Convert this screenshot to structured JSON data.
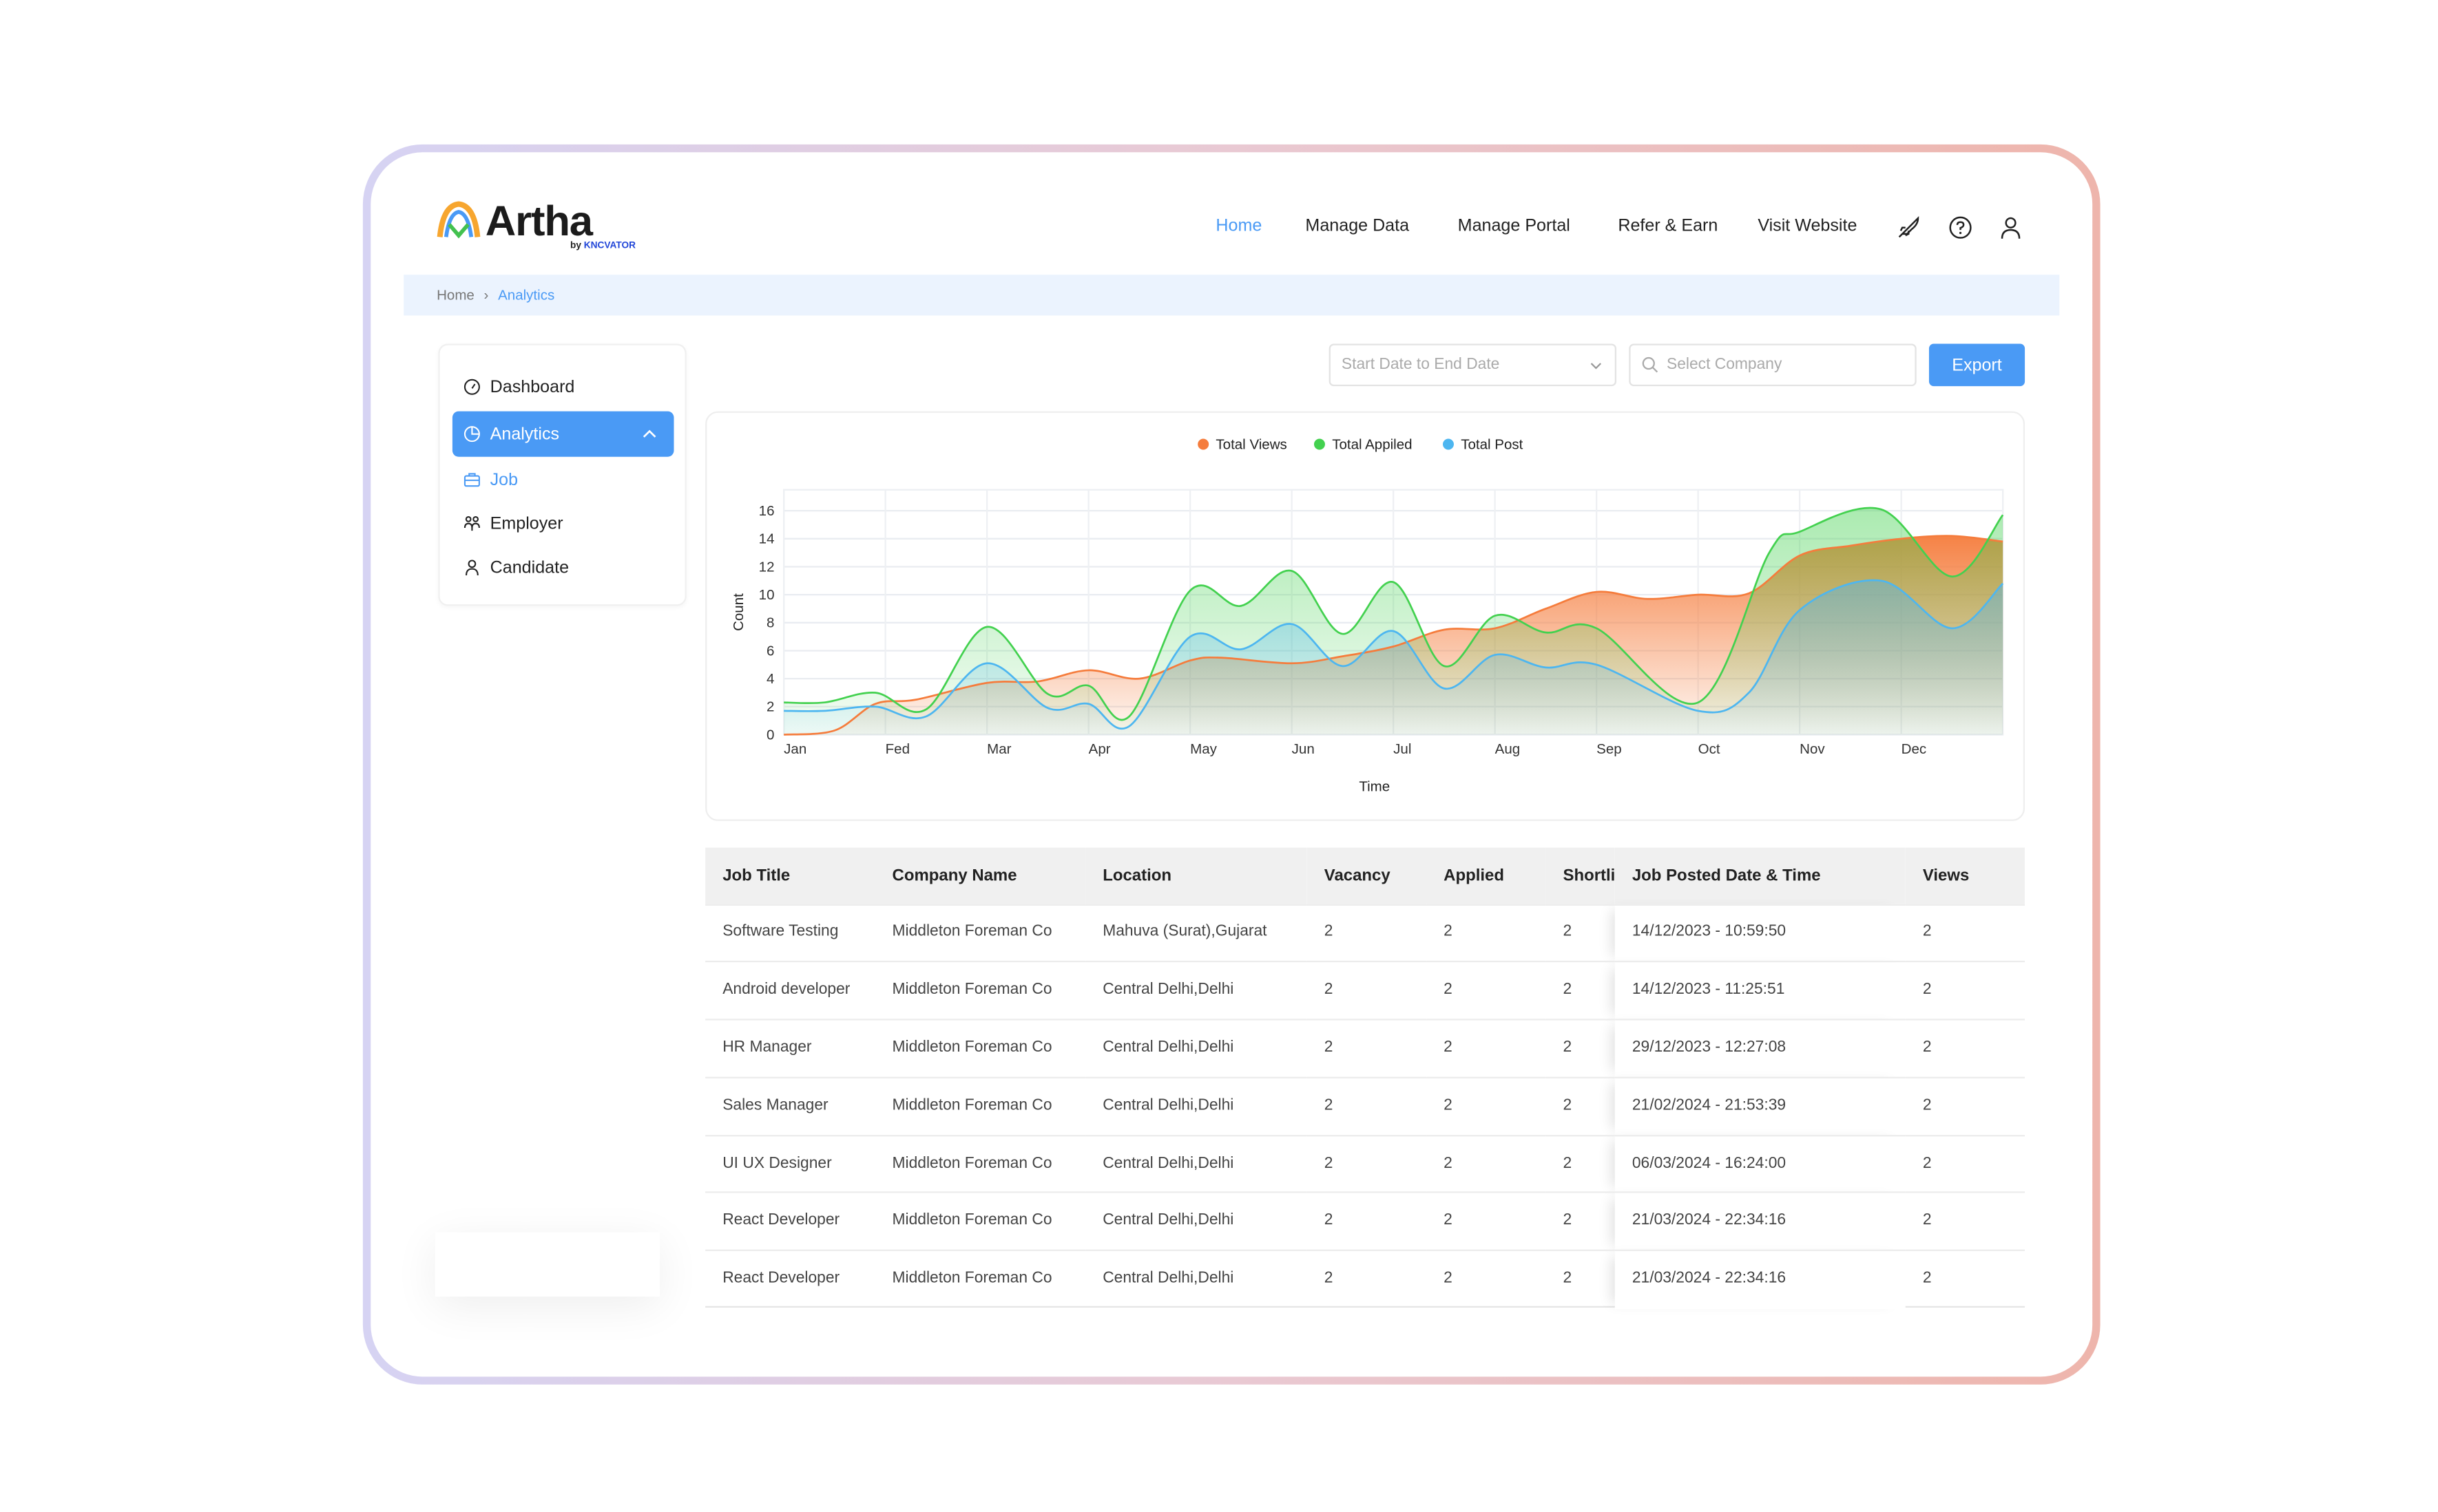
{
  "brand": {
    "name": "Artha",
    "by": "by",
    "maker": "KNCVATOR"
  },
  "nav": {
    "items": [
      {
        "label": "Home",
        "active": true
      },
      {
        "label": "Manage Data"
      },
      {
        "label": "Manage Portal"
      },
      {
        "label": "Refer & Earn"
      },
      {
        "label": "Visit Website"
      }
    ],
    "icons": [
      "rocket-icon",
      "help-icon",
      "user-icon"
    ]
  },
  "breadcrumb": {
    "home": "Home",
    "current": "Analytics"
  },
  "sidebar": {
    "items": [
      {
        "label": "Dashboard",
        "icon": "dashboard-icon"
      },
      {
        "label": "Analytics",
        "icon": "pie-chart-icon",
        "active": true,
        "expanded": true
      },
      {
        "label": "Job",
        "icon": "briefcase-icon",
        "sub": true
      },
      {
        "label": "Employer",
        "icon": "users-icon"
      },
      {
        "label": "Candidate",
        "icon": "user-icon"
      }
    ]
  },
  "filters": {
    "date_placeholder": "Start Date to End Date",
    "company_placeholder": "Select Company",
    "export_label": "Export"
  },
  "colors": {
    "accent": "#4a9af5",
    "views": "#f57c3c",
    "applied": "#43d14f",
    "post": "#4db6f0"
  },
  "chart_data": {
    "type": "area",
    "xlabel": "Time",
    "ylabel": "Count",
    "x_ticks": [
      "Jan",
      "Fed",
      "Mar",
      "Apr",
      "May",
      "Jun",
      "Jul",
      "Aug",
      "Sep",
      "Oct",
      "Nov",
      "Dec"
    ],
    "y_ticks": [
      0,
      2,
      4,
      6,
      8,
      10,
      12,
      14,
      16
    ],
    "ylim": [
      0,
      17.5
    ],
    "xlim": [
      1,
      13
    ],
    "grid": true,
    "legend": "top-center",
    "series": [
      {
        "name": "Total Views",
        "x": [
          1,
          1.5,
          1.9,
          2.3,
          3,
          3.5,
          4,
          4.5,
          5,
          5.3,
          6,
          6.5,
          7,
          7.5,
          8,
          8.5,
          9,
          9.5,
          10,
          10.5,
          11,
          11.5,
          12,
          12.5,
          13
        ],
        "values": [
          0,
          0.3,
          2.2,
          2.5,
          3.7,
          3.8,
          4.6,
          4.0,
          5.3,
          5.5,
          5.1,
          5.6,
          6.3,
          7.5,
          7.6,
          9.0,
          10.2,
          9.7,
          10.0,
          10.1,
          12.8,
          13.5,
          14.0,
          14.2,
          13.8
        ]
      },
      {
        "name": "Total Appiled",
        "x": [
          1,
          1.4,
          1.9,
          2.4,
          3,
          3.6,
          4,
          4.4,
          5,
          5.5,
          6,
          6.5,
          7,
          7.5,
          8,
          8.5,
          9,
          10,
          10.7,
          11,
          11.8,
          12.5,
          13
        ],
        "values": [
          2.3,
          2.3,
          3.0,
          1.8,
          7.7,
          2.9,
          3.5,
          1.3,
          10.3,
          9.2,
          11.7,
          7.2,
          10.9,
          4.9,
          8.5,
          7.3,
          7.6,
          2.3,
          13.0,
          14.5,
          16.1,
          11.3,
          15.7
        ]
      },
      {
        "name": "Total Post",
        "x": [
          1,
          1.4,
          1.9,
          2.4,
          3,
          3.6,
          4,
          4.4,
          5,
          5.5,
          6,
          6.5,
          7,
          7.5,
          8,
          8.5,
          9,
          10,
          10.5,
          11,
          11.8,
          12.5,
          13
        ],
        "values": [
          1.7,
          1.7,
          2.0,
          1.3,
          5.1,
          1.9,
          2.2,
          0.6,
          7.0,
          6.1,
          7.9,
          4.9,
          7.4,
          3.3,
          5.7,
          4.8,
          5.0,
          1.7,
          3.0,
          8.9,
          11.0,
          7.6,
          10.8
        ]
      }
    ]
  },
  "table": {
    "columns": [
      "Job Title",
      "Company Name",
      "Location",
      "Vacancy",
      "Applied",
      "Shortli",
      "Job Posted Date & Time",
      "Views"
    ],
    "rows": [
      [
        "Software Testing",
        "Middleton Foreman Co",
        "Mahuva (Surat),Gujarat",
        "2",
        "2",
        "2",
        "14/12/2023 - 10:59:50",
        "2"
      ],
      [
        "Android developer",
        "Middleton Foreman Co",
        "Central Delhi,Delhi",
        "2",
        "2",
        "2",
        "14/12/2023 - 11:25:51",
        "2"
      ],
      [
        "HR Manager",
        "Middleton Foreman Co",
        "Central Delhi,Delhi",
        "2",
        "2",
        "2",
        "29/12/2023 - 12:27:08",
        "2"
      ],
      [
        "Sales Manager",
        "Middleton Foreman Co",
        "Central Delhi,Delhi",
        "2",
        "2",
        "2",
        "21/02/2024 - 21:53:39",
        "2"
      ],
      [
        "UI UX Designer",
        "Middleton Foreman Co",
        "Central Delhi,Delhi",
        "2",
        "2",
        "2",
        "06/03/2024 - 16:24:00",
        "2"
      ],
      [
        "React Developer",
        "Middleton Foreman Co",
        "Central Delhi,Delhi",
        "2",
        "2",
        "2",
        "21/03/2024 - 22:34:16",
        "2"
      ],
      [
        "React Developer",
        "Middleton Foreman Co",
        "Central Delhi,Delhi",
        "2",
        "2",
        "2",
        "21/03/2024 - 22:34:16",
        "2"
      ]
    ]
  }
}
